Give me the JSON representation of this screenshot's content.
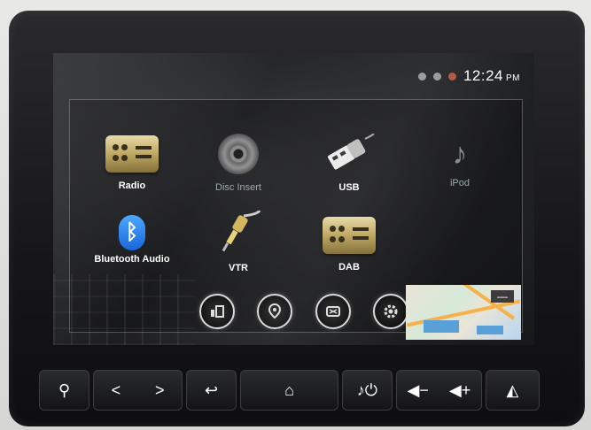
{
  "status": {
    "time": "12:24",
    "ampm": "PM"
  },
  "apps": [
    {
      "label": "Radio",
      "icon": "radio-icon"
    },
    {
      "label": "Disc Insert",
      "icon": "disc-icon"
    },
    {
      "label": "USB",
      "icon": "usb-icon"
    },
    {
      "label": "iPod",
      "icon": "ipod-icon"
    },
    {
      "label": "Bluetooth Audio",
      "icon": "bluetooth-icon"
    },
    {
      "label": "VTR",
      "icon": "aux-cable-icon"
    },
    {
      "label": "DAB",
      "icon": "dab-radio-icon"
    }
  ],
  "dock": [
    {
      "icon": "audio-icon"
    },
    {
      "icon": "navigation-icon"
    },
    {
      "icon": "phone-icon"
    },
    {
      "icon": "settings-icon"
    }
  ],
  "map": {
    "zoom_symbol": "—"
  },
  "hardware_buttons": {
    "location": "⚲",
    "prev": "<",
    "next": ">",
    "back": "↩",
    "home": "⌂",
    "media_power": "♪⏻",
    "vol_down": "◀−",
    "vol_up": "◀+",
    "nav": "◭"
  },
  "colors": {
    "bluetooth": "#1e7ff0",
    "radio_gold": "#c8b16a"
  }
}
